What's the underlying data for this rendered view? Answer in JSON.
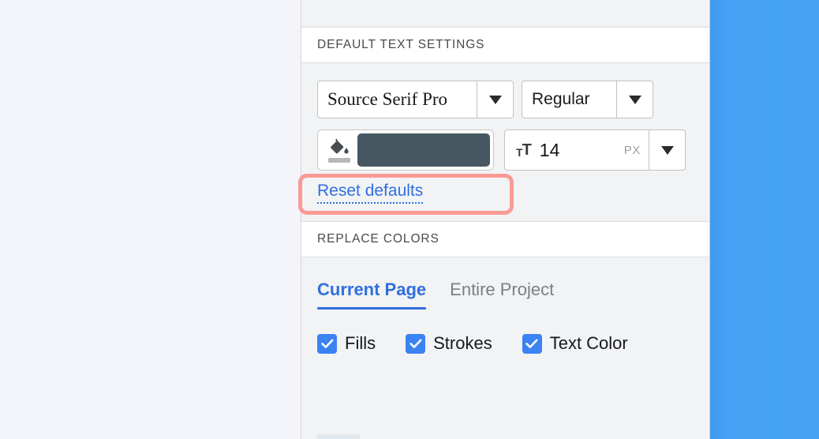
{
  "panel": {
    "sections": [
      {
        "id": "default-text-settings",
        "title": "DEFAULT TEXT SETTINGS"
      },
      {
        "id": "replace-colors",
        "title": "REPLACE COLORS"
      }
    ]
  },
  "text_settings": {
    "font_family": {
      "value": "Source Serif Pro",
      "caret_icon": "chevron-down-icon"
    },
    "font_style": {
      "value": "Regular",
      "caret_icon": "chevron-down-icon"
    },
    "text_color": {
      "icon": "paint-bucket-icon",
      "swatch_hex": "#475761"
    },
    "font_size": {
      "icon": "font-size-icon",
      "icon_small": "T",
      "icon_large": "T",
      "value": "14",
      "unit": "PX",
      "caret_icon": "chevron-down-icon"
    },
    "reset_link": {
      "label": "Reset defaults",
      "color_hex": "#2F6FE0",
      "highlight_hex": "#FB9A95"
    }
  },
  "replace_colors": {
    "tabs": [
      {
        "label": "Current Page",
        "active": true
      },
      {
        "label": "Entire Project",
        "active": false
      }
    ],
    "accent_hex": "#2F6FE0",
    "checkboxes": [
      {
        "label": "Fills",
        "checked": true
      },
      {
        "label": "Strokes",
        "checked": true
      },
      {
        "label": "Text Color",
        "checked": true
      }
    ],
    "checkbox_hex": "#3B82F3"
  },
  "artboard": {
    "fill_hex": "#44A1F4"
  },
  "canvas": {
    "background_hex": "#F4F4FB"
  }
}
